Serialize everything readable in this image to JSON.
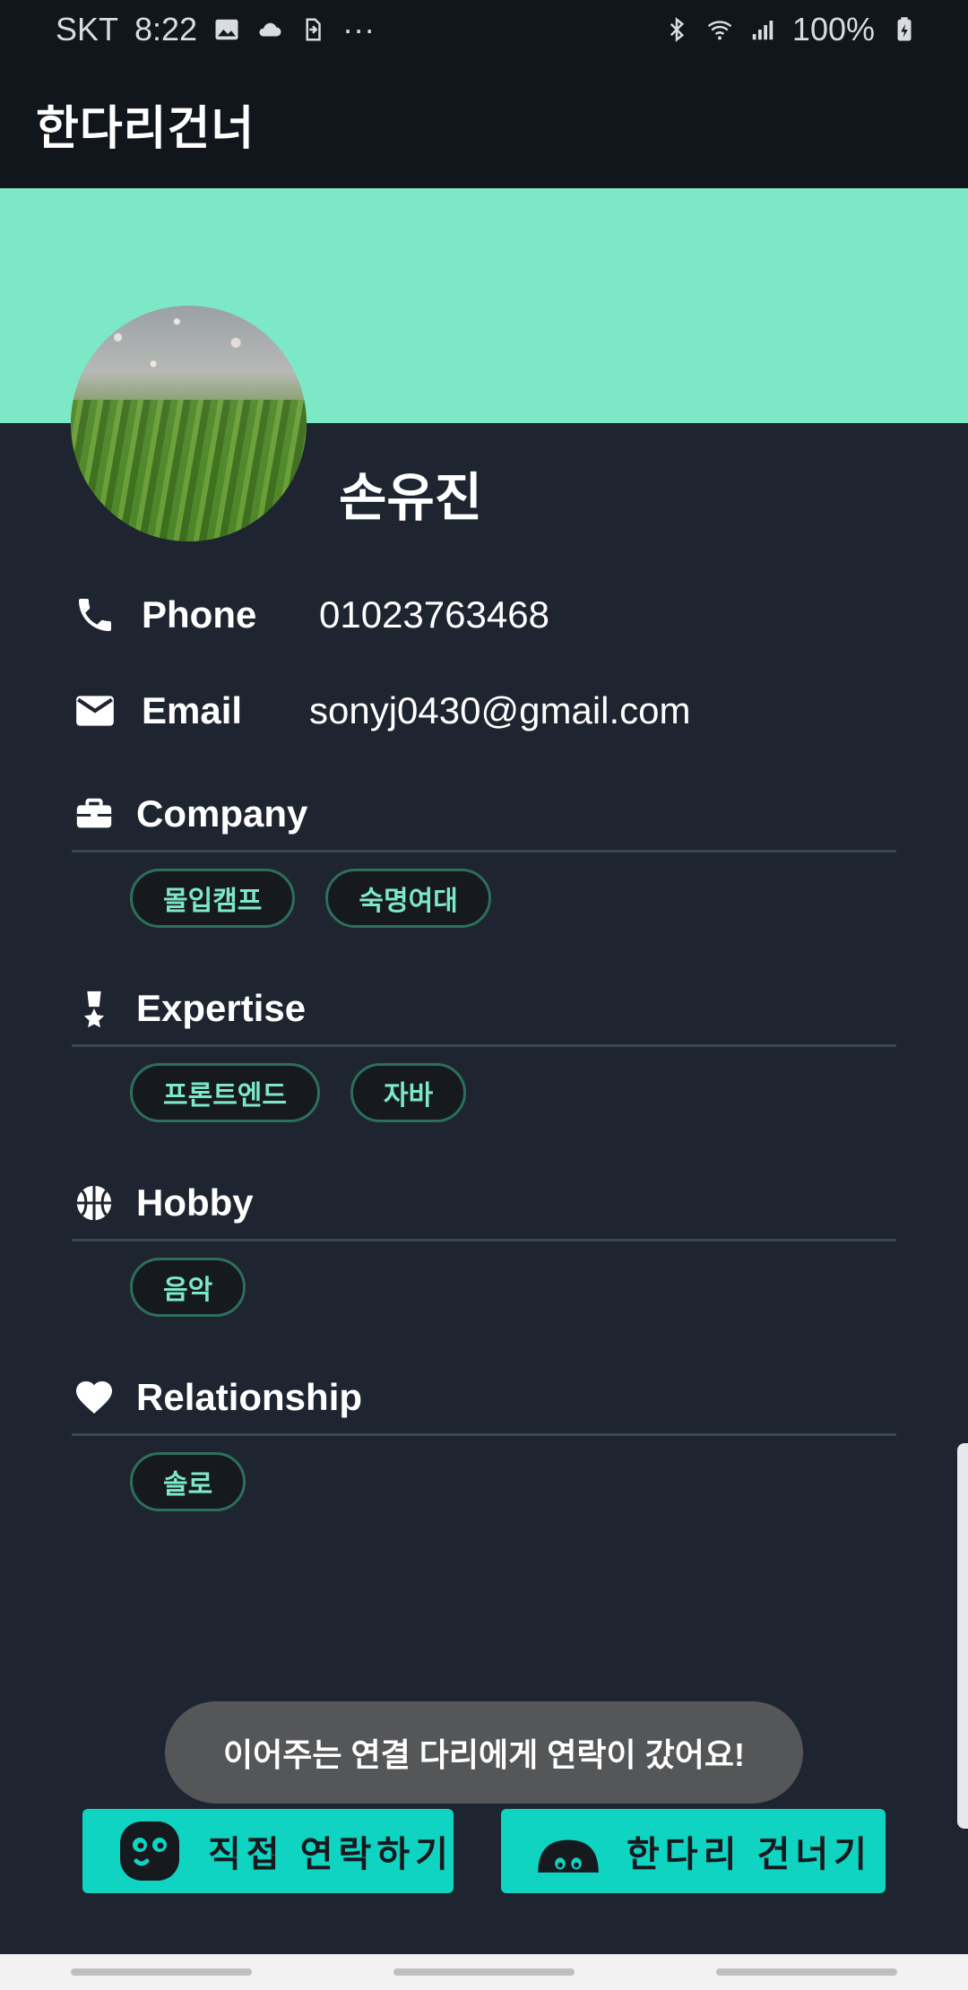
{
  "status_bar": {
    "carrier": "SKT",
    "time": "8:22",
    "more": "···",
    "battery": "100%"
  },
  "app_bar": {
    "title": "한다리건너"
  },
  "profile": {
    "name": "손유진",
    "phone_label": "Phone",
    "phone": "01023763468",
    "email_label": "Email",
    "email": "sonyj0430@gmail.com"
  },
  "sections": {
    "company": {
      "title": "Company",
      "chips": [
        "몰입캠프",
        "숙명여대"
      ]
    },
    "expertise": {
      "title": "Expertise",
      "chips": [
        "프론트엔드",
        "자바"
      ]
    },
    "hobby": {
      "title": "Hobby",
      "chips": [
        "음악"
      ]
    },
    "relationship": {
      "title": "Relationship",
      "chips": [
        "솔로"
      ]
    }
  },
  "toast": {
    "message": "이어주는 연결 다리에게 연락이 갔어요!"
  },
  "buttons": {
    "direct_contact": "직접 연락하기",
    "bridge": "한다리 건너기"
  },
  "colors": {
    "accent": "#7de8c6",
    "button": "#0fd4c2",
    "background": "#1f2530",
    "bar": "#11151c"
  }
}
